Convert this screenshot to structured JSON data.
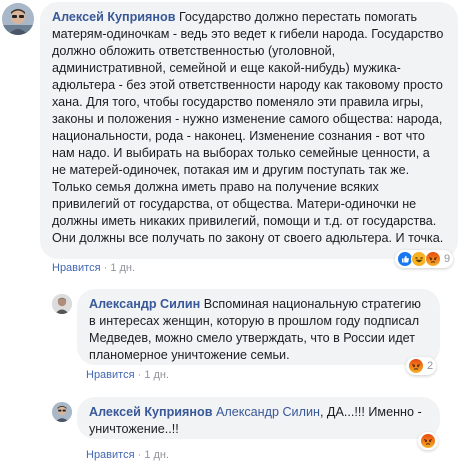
{
  "comments": [
    {
      "author": "Алексей Куприянов",
      "mention": "",
      "text": "Государство должно перестать помогать матерям-одиночкам - ведь это ведет к гибели народа. Государство должно обложить ответственностью (уголовной, административной, семейной и еще какой-нибудь) мужика-адюльтера - без этой ответственности народу как таковому просто хана. Для того, чтобы государство поменяло эти правила игры, законы и положения - нужно изменение самого общества: народа, национальности, рода - наконец. Изменение сознания - вот что нам надо. И выбирать на выборах только семейные ценности, а не матерей-одиночек, потакая им и другим поступать так же. Только семья должна иметь право на получение всяких привилегий от государства, от общества. Матери-одиночки не должны иметь никаких привилегий, помощи и т.д. от государства. Они должны все получать по закону от своего адюльтера. И точка.",
      "like_label": "Нравится",
      "dot": "·",
      "time": "1 дн.",
      "reactions": [
        "like",
        "haha",
        "angry"
      ],
      "reaction_count": "9"
    },
    {
      "author": "Александр Силин",
      "mention": "",
      "text": "Вспоминая национальную стратегию в интересах женщин, которую в прошлом году подписал Медведев, можно смело утверждать, что в России идет планомерное уничтожение семьи.",
      "like_label": "Нравится",
      "dot": "·",
      "time": "1 дн.",
      "reactions": [
        "angry"
      ],
      "reaction_count": "2"
    },
    {
      "author": "Алексей Куприянов",
      "mention": "Александр Силин",
      "text": ", ДА...!!! Именно - уничтожение..!!",
      "like_label": "Нравится",
      "dot": "·",
      "time": "1 дн.",
      "reactions": [
        "angry"
      ],
      "reaction_count": ""
    }
  ],
  "colors": {
    "link": "#385898",
    "like": "#4267b2",
    "bubble": "#f2f3f5",
    "meta": "#90949c",
    "like_reaction": "#1877f2",
    "haha_reaction": "#f7b125",
    "angry_reaction": "#e9710f"
  },
  "icons": {
    "avatar_1": "avatar-man-sunglasses",
    "avatar_2": "avatar-man-portrait",
    "avatar_3": "avatar-man-sunglasses"
  }
}
